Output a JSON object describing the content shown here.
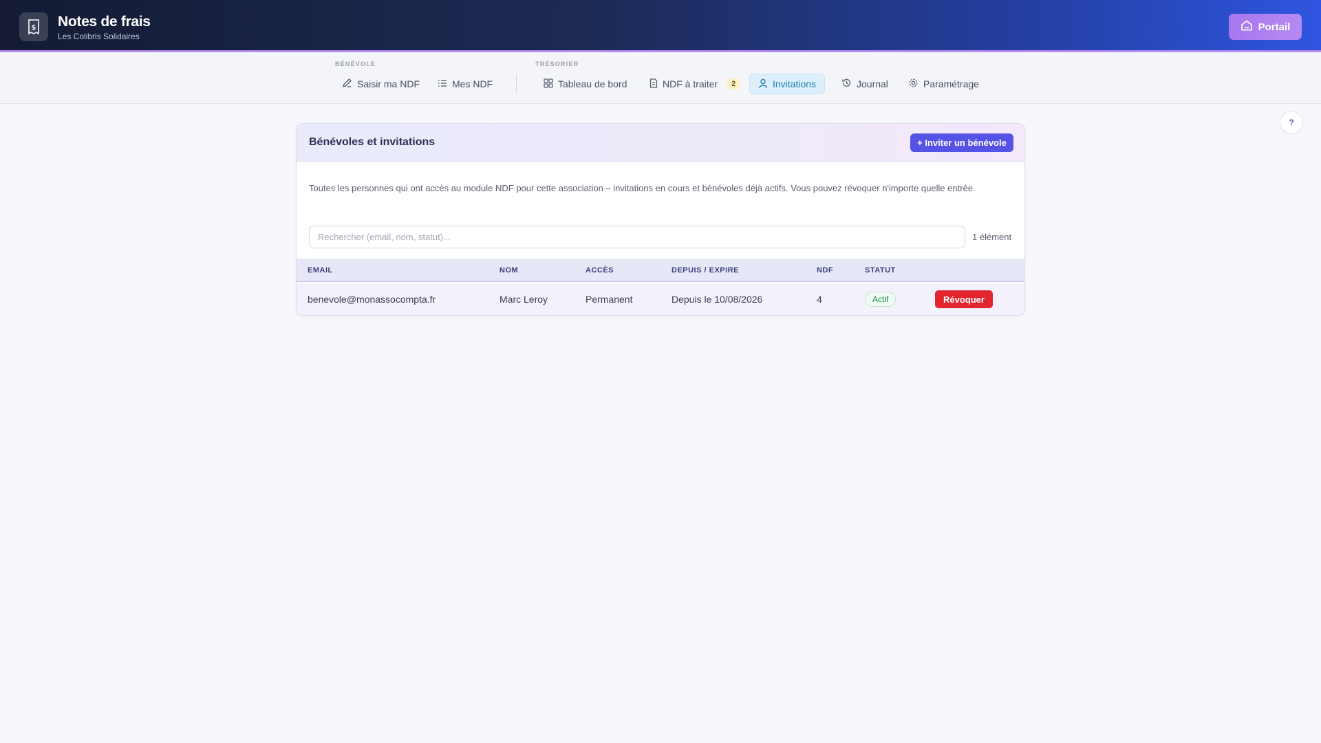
{
  "header": {
    "title": "Notes de frais",
    "subtitle": "Les Colibris Solidaires",
    "app_icon": "receipt-dollar-icon",
    "portal_label": "Portail",
    "portal_icon": "home-icon"
  },
  "nav": {
    "groups": [
      {
        "label": "BÉNÉVOLE"
      },
      {
        "label": "TRÉSORIER"
      }
    ],
    "items": [
      {
        "label": "Saisir ma NDF",
        "icon": "edit-icon"
      },
      {
        "label": "Mes NDF",
        "icon": "list-icon"
      },
      {
        "label": "Tableau de bord",
        "icon": "dashboard-icon"
      },
      {
        "label": "NDF à traiter",
        "icon": "document-icon",
        "badge": "2"
      },
      {
        "label": "Invitations",
        "icon": "user-icon",
        "active": true
      },
      {
        "label": "Journal",
        "icon": "history-icon"
      },
      {
        "label": "Paramétrage",
        "icon": "gear-icon"
      }
    ]
  },
  "help": {
    "label": "?"
  },
  "card": {
    "title": "Bénévoles et invitations",
    "invite_label": "+ Inviter un bénévole",
    "description": "Toutes les personnes qui ont accès au module NDF pour cette association – invitations en cours et bénévoles déjà actifs. Vous pouvez révoquer n'importe quelle entrée.",
    "search": {
      "placeholder": "Rechercher (email, nom, statut)...",
      "value": ""
    },
    "count_label": "1 élément",
    "table": {
      "columns": [
        "EMAIL",
        "NOM",
        "ACCÈS",
        "DEPUIS / EXPIRE",
        "NDF",
        "STATUT"
      ],
      "rows": [
        {
          "email": "benevole@monassocompta.fr",
          "name": "Marc Leroy",
          "access": "Permanent",
          "since": "Depuis le 10/08/2026",
          "ndf": "4",
          "status": "Actif",
          "action": "Révoquer"
        }
      ]
    }
  },
  "colors": {
    "accent": "#5552e6",
    "active_tab": "#1f7fb8",
    "danger": "#e3252f",
    "success": "#1f8a4a",
    "portal": "#a677ee"
  }
}
